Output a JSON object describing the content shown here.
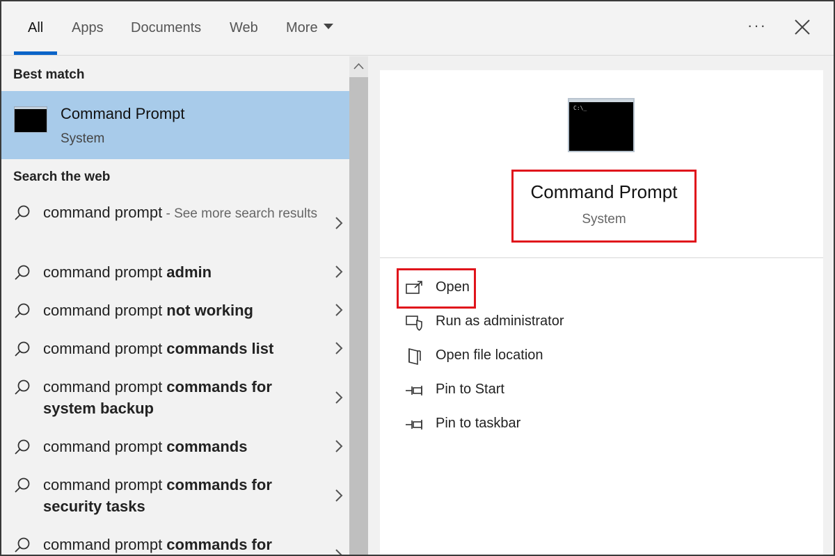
{
  "tabs": [
    {
      "label": "All"
    },
    {
      "label": "Apps"
    },
    {
      "label": "Documents"
    },
    {
      "label": "Web"
    },
    {
      "label": "More"
    }
  ],
  "toolbar": {
    "more_options": "···"
  },
  "best_match": {
    "heading": "Best match",
    "title": "Command Prompt",
    "subtitle": "System"
  },
  "web": {
    "heading": "Search the web",
    "items": [
      {
        "prefix": "command prompt",
        "bold": "",
        "suffix": " - See more search results"
      },
      {
        "prefix": "command prompt ",
        "bold": "admin",
        "suffix": ""
      },
      {
        "prefix": "command prompt ",
        "bold": "not working",
        "suffix": ""
      },
      {
        "prefix": "command prompt ",
        "bold": "commands list",
        "suffix": ""
      },
      {
        "prefix": "command prompt ",
        "bold": "commands for system backup",
        "suffix": ""
      },
      {
        "prefix": "command prompt ",
        "bold": "commands",
        "suffix": ""
      },
      {
        "prefix": "command prompt ",
        "bold": "commands for security tasks",
        "suffix": ""
      },
      {
        "prefix": "command prompt ",
        "bold": "commands for",
        "suffix": ""
      }
    ]
  },
  "detail": {
    "title": "Command Prompt",
    "subtitle": "System",
    "actions": [
      {
        "label": "Open"
      },
      {
        "label": "Run as administrator"
      },
      {
        "label": "Open file location"
      },
      {
        "label": "Pin to Start"
      },
      {
        "label": "Pin to taskbar"
      }
    ]
  },
  "colors": {
    "accent": "#0a64c8",
    "selected_row": "#a8cbea",
    "highlight_box": "#e0131b"
  }
}
